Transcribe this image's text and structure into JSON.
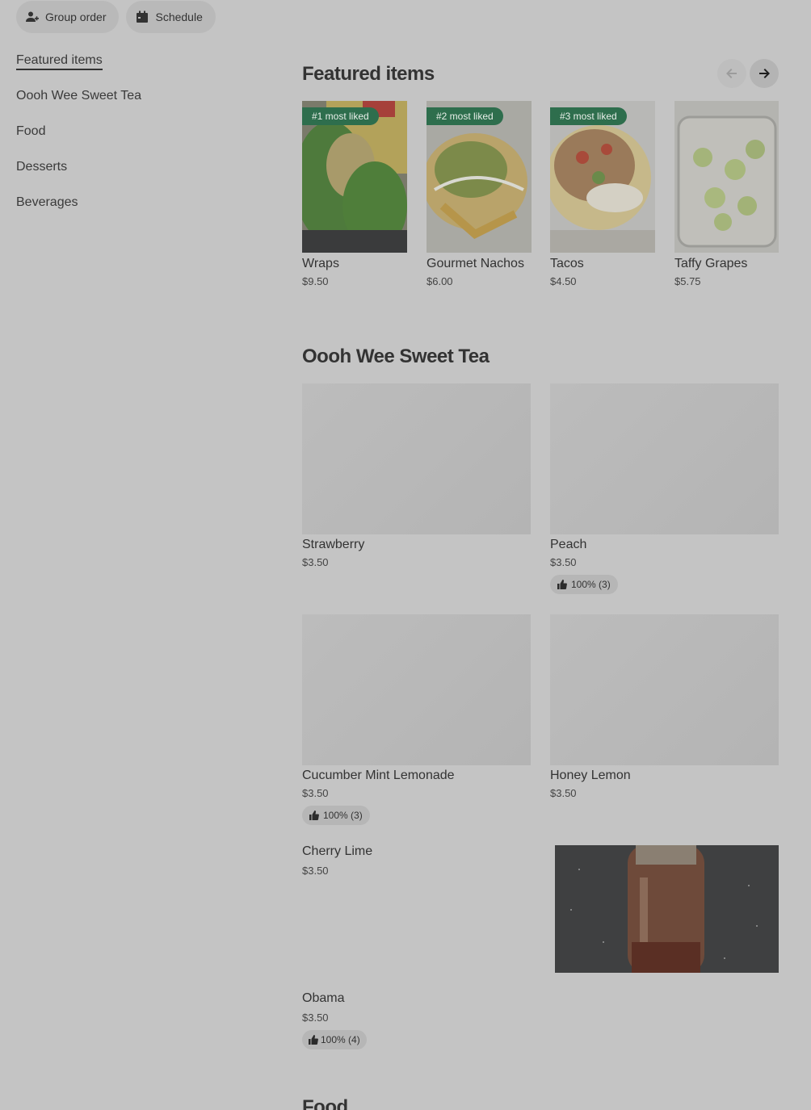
{
  "top_pills": [
    {
      "label": "Group order",
      "icon": "add-person-icon"
    },
    {
      "label": "Schedule",
      "icon": "calendar-icon"
    }
  ],
  "sidebar": {
    "items": [
      {
        "label": "Featured items",
        "active": true
      },
      {
        "label": "Oooh Wee Sweet Tea"
      },
      {
        "label": "Food"
      },
      {
        "label": "Desserts"
      },
      {
        "label": "Beverages"
      }
    ]
  },
  "featured": {
    "title": "Featured items",
    "prev_icon": "arrow-left-icon",
    "next_icon": "arrow-right-icon",
    "items": [
      {
        "badge": "#1 most liked",
        "name": "Wraps",
        "price": "$9.50"
      },
      {
        "badge": "#2 most liked",
        "name": "Gourmet Nachos",
        "price": "$6.00"
      },
      {
        "badge": "#3 most liked",
        "name": "Tacos",
        "price": "$4.50"
      },
      {
        "badge": "",
        "name": "Taffy Grapes",
        "price": "$5.75"
      }
    ]
  },
  "sweet_tea": {
    "title": "Oooh Wee Sweet Tea",
    "items": [
      {
        "name": "Strawberry",
        "price": "$3.50",
        "rating": ""
      },
      {
        "name": "Peach",
        "price": "$3.50",
        "rating": "100% (3)"
      },
      {
        "name": "Cucumber Mint Lemonade",
        "price": "$3.50",
        "rating": "100% (3)"
      },
      {
        "name": "Honey Lemon",
        "price": "$3.50",
        "rating": ""
      },
      {
        "name": "Cherry Lime",
        "price": "$3.50",
        "rating": ""
      },
      {
        "name": "Obama",
        "price": "$3.50",
        "rating": "100% (4)"
      }
    ]
  },
  "food": {
    "title": "Food"
  },
  "colors": {
    "background": "#c4c4c4",
    "badge_green": "#2e6e4d"
  }
}
